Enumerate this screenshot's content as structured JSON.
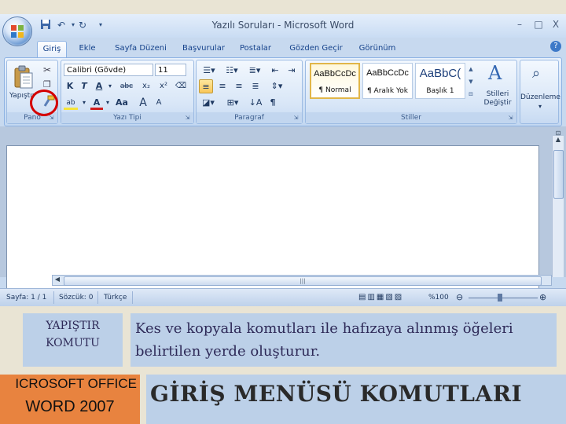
{
  "window": {
    "title": "Yazılı Soruları - Microsoft Word",
    "controls": {
      "minimize": "–",
      "maximize": "□",
      "close": "X"
    }
  },
  "quick_access": {
    "save_icon": "save-icon",
    "undo_icon": "undo-icon",
    "redo_icon": "redo-icon"
  },
  "tabs": [
    "Giriş",
    "Ekle",
    "Sayfa Düzeni",
    "Başvurular",
    "Postalar",
    "Gözden Geçir",
    "Görünüm"
  ],
  "active_tab": "Giriş",
  "ribbon": {
    "clipboard": {
      "label": "Pano",
      "paste_label": "Yapıştır"
    },
    "font": {
      "label": "Yazı Tipi",
      "font_name": "Calibri (Gövde)",
      "font_size": "11",
      "bold": "K",
      "italic": "T",
      "underline": "A",
      "strike": "abc",
      "subscript": "x₂",
      "superscript": "x²",
      "highlight": "ab",
      "font_color": "A",
      "change_case": "Aa",
      "grow": "A",
      "shrink": "A"
    },
    "paragraph": {
      "label": "Paragraf",
      "pilcrow": "¶"
    },
    "styles": {
      "label": "Stiller",
      "items": [
        {
          "preview": "AaBbCcDc",
          "name": "¶ Normal"
        },
        {
          "preview": "AaBbCcDc",
          "name": "¶ Aralık Yok"
        },
        {
          "preview": "AaBbC(",
          "name": "Başlık 1"
        }
      ],
      "change_styles": "Stilleri Değiştir"
    },
    "editing": {
      "label": "Düzenleme"
    }
  },
  "status_bar": {
    "page": "Sayfa: 1 / 1",
    "words": "Sözcük: 0",
    "language": "Türkçe",
    "zoom": "%100"
  },
  "slide": {
    "command_name": "YAPIŞTIR KOMUTU",
    "description": "Kes ve kopyala komutları ile hafızaya alınmış öğeleri belirtilen yerde oluşturur.",
    "product_line1": "ICROSOFT OFFICE",
    "product_line2": "WORD 2007",
    "heading": "GİRİŞ MENÜSÜ KOMUTLARI"
  },
  "colors": {
    "ribbon_blue": "#c7d9ef",
    "card_blue": "#bcd0e8",
    "product_orange": "#e8833f",
    "highlight_ring": "#d40000"
  }
}
